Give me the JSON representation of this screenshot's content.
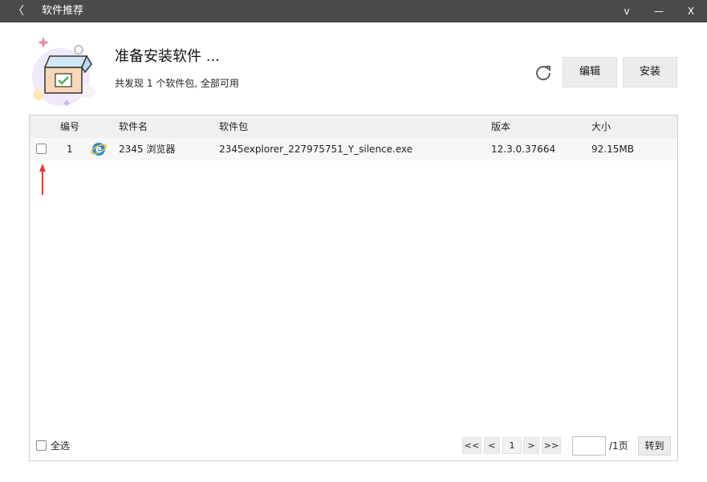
{
  "window": {
    "title": "软件推荐",
    "back_glyph": "〈",
    "minimize_glyph": "v",
    "maximize_glyph": "—",
    "close_glyph": "X"
  },
  "header": {
    "heading": "准备安装软件 ...",
    "subheading": "共发现 1 个软件包, 全部可用",
    "edit_label": "编辑",
    "install_label": "安装"
  },
  "table": {
    "columns": [
      "编号",
      "软件名",
      "软件包",
      "版本",
      "大小"
    ],
    "rows": [
      {
        "index": "1",
        "name": "2345 浏览器",
        "package": "2345explorer_227975751_Y_silence.exe",
        "version": "12.3.0.37664",
        "size": "92.15MB",
        "checked": false
      }
    ]
  },
  "footer": {
    "select_all_label": "全选",
    "first_page": "<<",
    "prev_page": "<",
    "current_page": "1",
    "next_page": ">",
    "last_page": ">>",
    "page_input_value": "",
    "total_pages": "/1页",
    "goto_label": "转到"
  },
  "colors": {
    "titlebar": "#4a4a4a",
    "annotation_arrow": "#e53935",
    "ie_blue": "#1e88e5"
  }
}
